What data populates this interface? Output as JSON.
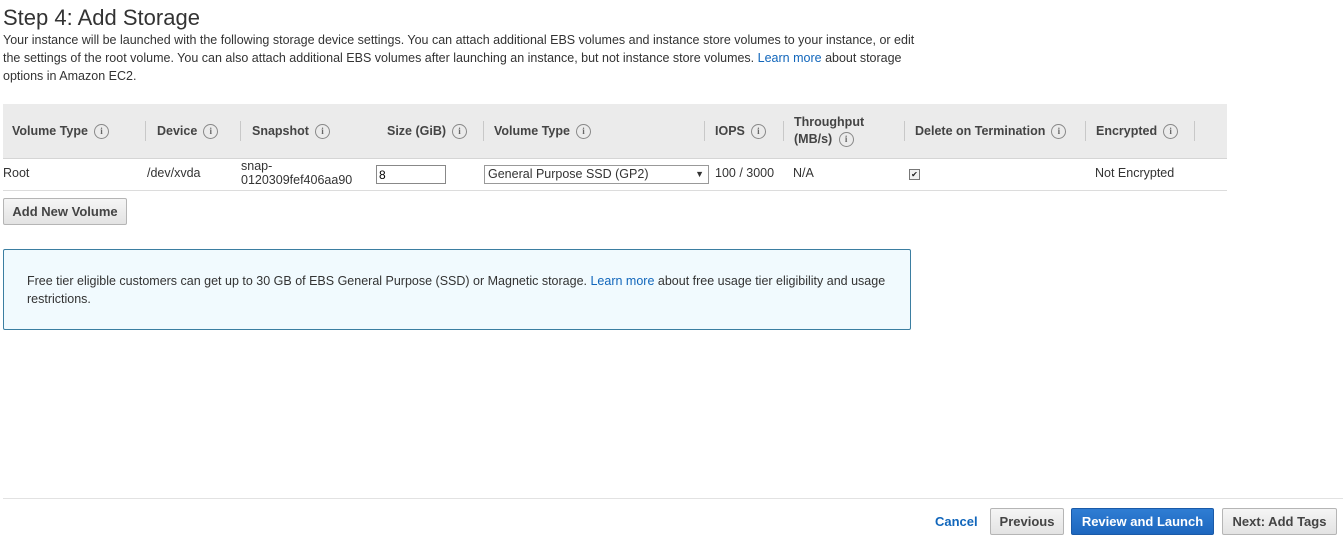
{
  "page": {
    "title": "Step 4: Add Storage",
    "intro_text": "Your instance will be launched with the following storage device settings. You can attach additional EBS volumes and instance store volumes to your instance, or edit the settings of the root volume. You can also attach additional EBS volumes after launching an instance, but not instance store volumes.",
    "intro_link": "Learn more",
    "intro_suffix": "about storage options in Amazon EC2."
  },
  "table": {
    "headers": {
      "volume_type": "Volume Type",
      "device": "Device",
      "snapshot": "Snapshot",
      "size": "Size (GiB)",
      "ebs_volume_type": "Volume Type",
      "iops": "IOPS",
      "throughput": "Throughput (MB/s)",
      "delete_on_termination": "Delete on Termination",
      "encrypted": "Encrypted"
    },
    "info_icon": "i",
    "rows": [
      {
        "volume_type": "Root",
        "device": "/dev/xvda",
        "snapshot_line1": "snap-",
        "snapshot_line2": "0120309fef406aa90",
        "size": "8",
        "ebs_volume_type": "General Purpose SSD (GP2)",
        "iops": "100 / 3000",
        "throughput": "N/A",
        "delete_on_termination": true,
        "encrypted": "Not Encrypted"
      }
    ]
  },
  "buttons": {
    "add_new_volume": "Add New Volume",
    "cancel": "Cancel",
    "previous": "Previous",
    "review_and_launch": "Review and Launch",
    "next": "Next: Add Tags"
  },
  "notice": {
    "text": "Free tier eligible customers can get up to 30 GB of EBS General Purpose (SSD) or Magnetic storage.",
    "link": "Learn more",
    "suffix": "about free usage tier eligibility and usage restrictions."
  },
  "colors": {
    "link": "#1166bb",
    "primary_button": "#1d67bf",
    "notice_bg": "#f1fafe",
    "notice_border": "#3b7ea1"
  }
}
